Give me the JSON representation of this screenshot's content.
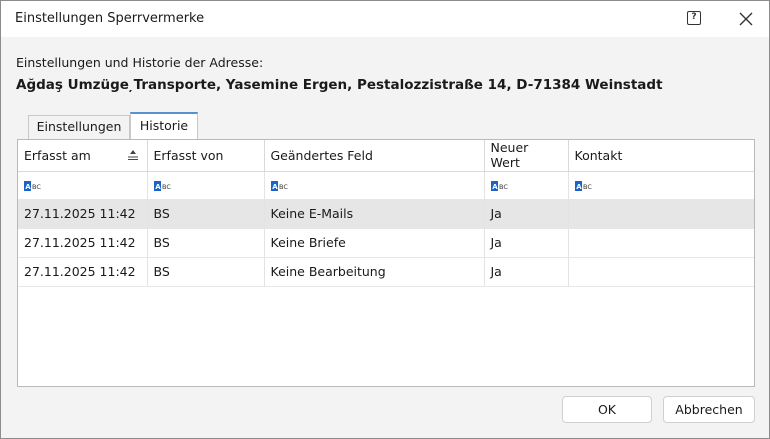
{
  "window": {
    "title": "Einstellungen Sperrvermerke"
  },
  "header": {
    "subtitle": "Einstellungen und Historie der Adresse:",
    "address": "Ağdaş Umzüge ̦Transporte, Yasemine Ergen, Pestalozzistraße 14, D-71384 Weinstadt"
  },
  "tabs": [
    {
      "label": "Einstellungen",
      "active": false
    },
    {
      "label": "Historie",
      "active": true
    }
  ],
  "grid": {
    "columns": [
      "Erfasst am",
      "Erfasst von",
      "Geändertes Feld",
      "Neuer Wert",
      "Kontakt"
    ],
    "filter_icon": "abc-filter-icon",
    "rows": [
      [
        "27.11.2025 11:42",
        "BS",
        "Keine E-Mails",
        "Ja",
        ""
      ],
      [
        "27.11.2025 11:42",
        "BS",
        "Keine Briefe",
        "Ja",
        ""
      ],
      [
        "27.11.2025 11:42",
        "BS",
        "Keine Bearbeitung",
        "Ja",
        ""
      ]
    ],
    "selected_row": 0
  },
  "buttons": {
    "ok": "OK",
    "cancel": "Abbrechen"
  },
  "colors": {
    "accent": "#5a8fd0",
    "selected_row": "#e6e6e6",
    "abc_icon": "#1a64c8"
  }
}
